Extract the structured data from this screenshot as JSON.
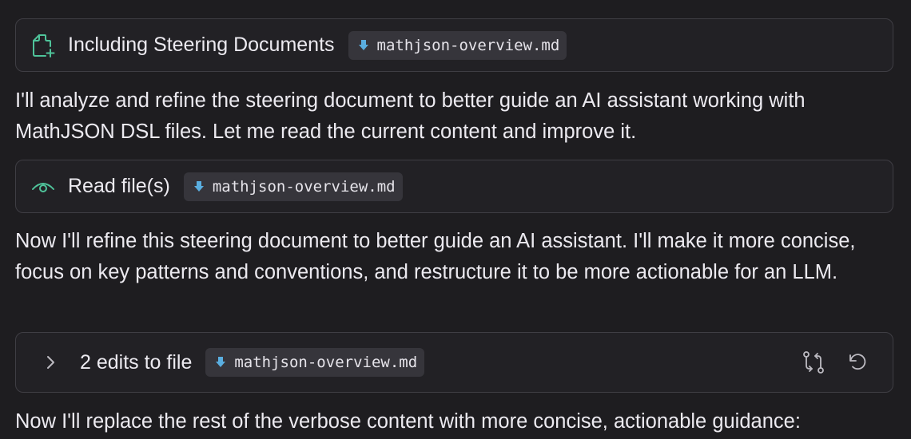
{
  "steering": {
    "title": "Including Steering Documents",
    "file": "mathjson-overview.md",
    "icon": "file-plus-icon"
  },
  "message1": "I'll analyze and refine the steering document to better guide an AI assistant working with MathJSON DSL files. Let me read the current content and improve it.",
  "read": {
    "title": "Read file(s)",
    "file": "mathjson-overview.md",
    "icon": "eye-icon"
  },
  "message2": "Now I'll refine this steering document to better guide an AI assistant. I'll make it more concise, focus on key patterns and conventions, and restructure it to be more actionable for an LLM.",
  "edits": {
    "title": "2 edits to file",
    "file": "mathjson-overview.md",
    "expand_icon": "chevron-right-icon",
    "diff_icon": "compare-icon",
    "undo_icon": "undo-icon"
  },
  "message3": "Now I'll replace the rest of the verbose content with more concise, actionable guidance:",
  "colors": {
    "background": "#1e1d20",
    "card_border": "#3f3e44",
    "chip_bg": "#36353b",
    "accent_green": "#4fc39a",
    "file_icon_blue": "#5aaee0"
  }
}
